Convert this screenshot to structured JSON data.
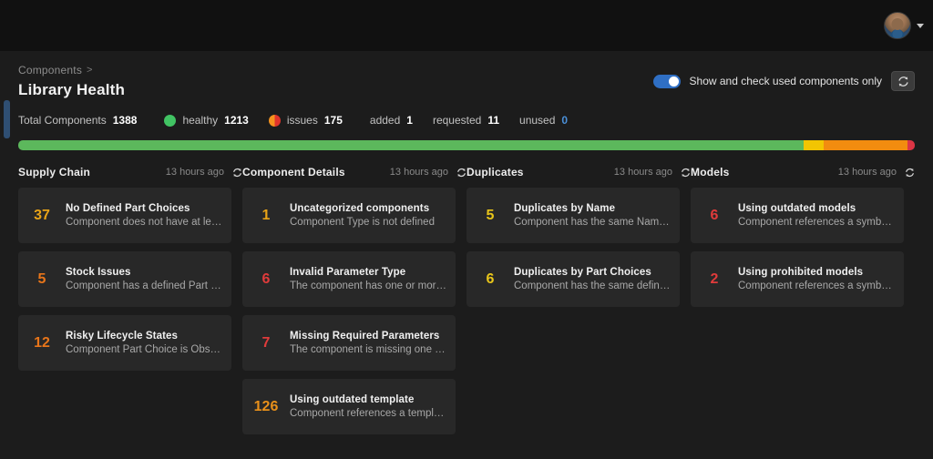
{
  "topbar": {
    "avatar_name": "user-avatar",
    "menu_caret": "chevron-down-icon"
  },
  "header": {
    "breadcrumb_parent": "Components",
    "breadcrumb_separator": ">",
    "title": "Library Health",
    "toggle_label": "Show and check used components only",
    "toggle_on": true,
    "refresh_tooltip": "refresh-icon"
  },
  "stats": {
    "total_label": "Total Components",
    "total_value": "1388",
    "healthy_label": "healthy",
    "healthy_value": "1213",
    "issues_label": "issues",
    "issues_value": "175",
    "added_label": "added",
    "added_value": "1",
    "requested_label": "requested",
    "requested_value": "11",
    "unused_label": "unused",
    "unused_value": "0"
  },
  "healthbar": {
    "segments": [
      {
        "color": "#5cb85c",
        "width_pct": 87.6
      },
      {
        "color": "#f2c502",
        "width_pct": 2.2
      },
      {
        "color": "#f28c0f",
        "width_pct": 9.4
      },
      {
        "color": "#dc3545",
        "width_pct": 0.8
      }
    ]
  },
  "colors": {
    "amber": "#e8a317",
    "orange": "#e8751a",
    "red": "#e03b3b",
    "gold": "#e8c51a",
    "accent": "#2f6fc4",
    "card_bg": "#282828",
    "panel_bg": "#1c1c1c"
  },
  "columns": [
    {
      "title": "Supply Chain",
      "timestamp": "13 hours ago",
      "cards": [
        {
          "count": "37",
          "count_color": "#e8a317",
          "title": "No Defined Part Choices",
          "desc": "Component does not have at leas..."
        },
        {
          "count": "5",
          "count_color": "#e8751a",
          "title": "Stock Issues",
          "desc": "Component has a defined Part Ch..."
        },
        {
          "count": "12",
          "count_color": "#e8751a",
          "title": "Risky Lifecycle States",
          "desc": "Component Part Choice is Obsole..."
        }
      ]
    },
    {
      "title": "Component Details",
      "timestamp": "13 hours ago",
      "cards": [
        {
          "count": "1",
          "count_color": "#e8a317",
          "title": "Uncategorized components",
          "desc": "Component Type is not defined"
        },
        {
          "count": "6",
          "count_color": "#e03b3b",
          "title": "Invalid Parameter Type",
          "desc": "The component has one or more ..."
        },
        {
          "count": "7",
          "count_color": "#e03b3b",
          "title": "Missing Required Parameters",
          "desc": "The component is missing one or ..."
        },
        {
          "count": "126",
          "count_color": "#e8901a",
          "title": "Using outdated template",
          "desc": "Component references a templat..."
        }
      ]
    },
    {
      "title": "Duplicates",
      "timestamp": "13 hours ago",
      "cards": [
        {
          "count": "5",
          "count_color": "#e8c51a",
          "title": "Duplicates by Name",
          "desc": "Component has the same Name a..."
        },
        {
          "count": "6",
          "count_color": "#e8c51a",
          "title": "Duplicates by Part Choices",
          "desc": "Component has the same defined..."
        }
      ]
    },
    {
      "title": "Models",
      "timestamp": "13 hours ago",
      "cards": [
        {
          "count": "6",
          "count_color": "#e03b3b",
          "title": "Using outdated models",
          "desc": "Component references a symbol ..."
        },
        {
          "count": "2",
          "count_color": "#e03b3b",
          "title": "Using prohibited models",
          "desc": "Component references a symbol ..."
        }
      ]
    }
  ]
}
